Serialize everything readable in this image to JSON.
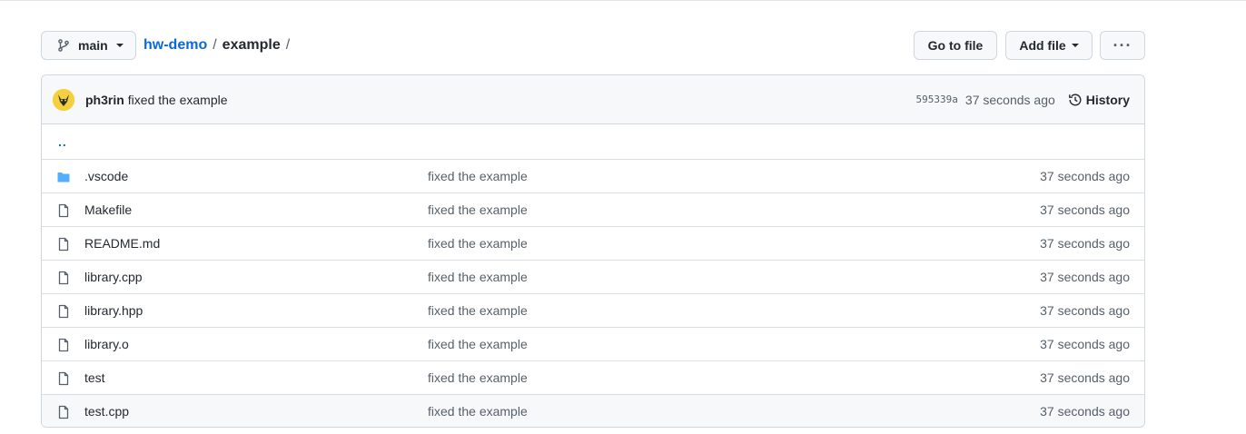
{
  "toolbar": {
    "branch": "main",
    "repo": "hw-demo",
    "path_separator": "/",
    "current_dir": "example",
    "trailing_separator": "/",
    "go_to_file": "Go to file",
    "add_file": "Add file",
    "more": "···"
  },
  "commit": {
    "author": "ph3rin",
    "message": "fixed the example",
    "sha": "595339a",
    "time": "37 seconds ago",
    "history_label": "History"
  },
  "parent_dir": "..",
  "files": [
    {
      "name": ".vscode",
      "type": "folder",
      "message": "fixed the example",
      "age": "37 seconds ago"
    },
    {
      "name": "Makefile",
      "type": "file",
      "message": "fixed the example",
      "age": "37 seconds ago"
    },
    {
      "name": "README.md",
      "type": "file",
      "message": "fixed the example",
      "age": "37 seconds ago"
    },
    {
      "name": "library.cpp",
      "type": "file",
      "message": "fixed the example",
      "age": "37 seconds ago"
    },
    {
      "name": "library.hpp",
      "type": "file",
      "message": "fixed the example",
      "age": "37 seconds ago"
    },
    {
      "name": "library.o",
      "type": "file",
      "message": "fixed the example",
      "age": "37 seconds ago"
    },
    {
      "name": "test",
      "type": "file",
      "message": "fixed the example",
      "age": "37 seconds ago"
    },
    {
      "name": "test.cpp",
      "type": "file",
      "message": "fixed the example",
      "age": "37 seconds ago"
    }
  ],
  "colors": {
    "link": "#0969da",
    "folder": "#54aeff",
    "file_icon": "#57606a",
    "muted_text": "#57606a"
  }
}
